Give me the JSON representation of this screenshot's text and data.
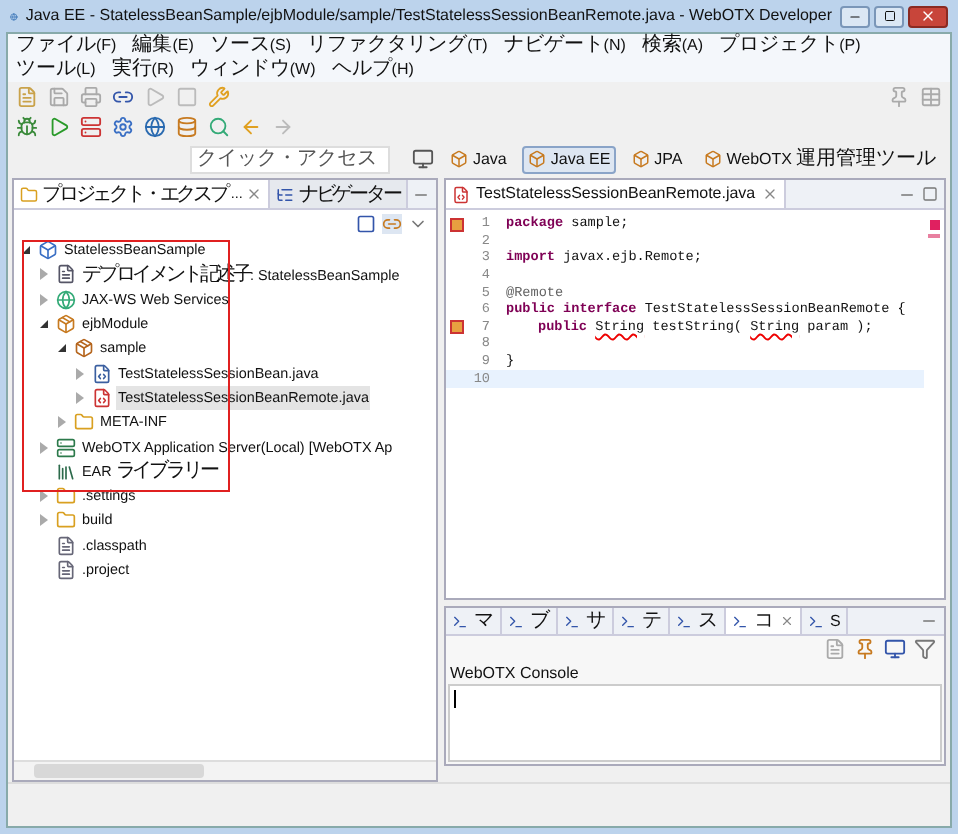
{
  "window": {
    "title": "Java EE - StatelessBeanSample/ejbModule/sample/TestStatelessSessionBeanRemote.java - WebOTX Developer"
  },
  "menu": [
    "ファイル(F)",
    "編集(E)",
    "ソース(S)",
    "リファクタリング(T)",
    "ナビゲート(N)",
    "検索(A)",
    "プロジェクト(P)",
    "ツール(L)",
    "実行(R)",
    "ウィンドウ(W)",
    "ヘルプ(H)"
  ],
  "quick_access": {
    "placeholder": "クイック・アクセス"
  },
  "perspectives": [
    {
      "label": "Java",
      "selected": false
    },
    {
      "label": "Java EE",
      "selected": true
    },
    {
      "label": "JPA",
      "selected": false
    },
    {
      "label": "WebOTX 運用管理ツール",
      "selected": false
    }
  ],
  "left_panel": {
    "tabs": [
      {
        "label": "プロジェクト・エクスプ...",
        "selected": true
      },
      {
        "label": "ナビゲーター",
        "selected": false
      }
    ],
    "tree": [
      {
        "label": "StatelessBeanSample",
        "kind": "project",
        "expanded": true,
        "selected": false,
        "children": [
          {
            "label": "デプロイメント記述子: StatelessBeanSample",
            "kind": "descriptor",
            "expanded": false,
            "selected": false
          },
          {
            "label": "JAX-WS Web Services",
            "kind": "webservice",
            "expanded": false,
            "selected": false
          },
          {
            "label": "ejbModule",
            "kind": "module",
            "expanded": true,
            "selected": false,
            "children": [
              {
                "label": "sample",
                "kind": "package",
                "expanded": true,
                "selected": false,
                "children": [
                  {
                    "label": "TestStatelessSessionBean.java",
                    "kind": "java",
                    "expanded": false,
                    "selected": false
                  },
                  {
                    "label": "TestStatelessSessionBeanRemote.java",
                    "kind": "java-error",
                    "expanded": false,
                    "selected": true
                  }
                ]
              },
              {
                "label": "META-INF",
                "kind": "folder",
                "expanded": false,
                "selected": false
              }
            ]
          },
          {
            "label": "WebOTX Application Server(Local) [WebOTX Ap",
            "kind": "server",
            "expanded": false,
            "selected": false
          },
          {
            "label": "EAR ライブラリー",
            "kind": "library",
            "selected": false
          },
          {
            "label": ".settings",
            "kind": "folder",
            "expanded": false,
            "selected": false
          },
          {
            "label": "build",
            "kind": "folder",
            "expanded": false,
            "selected": false
          },
          {
            "label": ".classpath",
            "kind": "xml",
            "selected": false
          },
          {
            "label": ".project",
            "kind": "xml",
            "selected": false
          }
        ]
      }
    ]
  },
  "editor": {
    "tab": "TestStatelessSessionBeanRemote.java",
    "lines": [
      {
        "number": "1",
        "marker": true,
        "segments": [
          {
            "text": "package",
            "kind": "keyword"
          },
          {
            "text": " sample;",
            "kind": "plain"
          }
        ]
      },
      {
        "number": "2",
        "marker": false
      },
      {
        "number": "3",
        "marker": false,
        "segments": [
          {
            "text": "import",
            "kind": "keyword"
          },
          {
            "text": " javax.ejb.Remote;",
            "kind": "plain"
          }
        ]
      },
      {
        "number": "4",
        "marker": false
      },
      {
        "number": "5",
        "marker": false,
        "segments": [
          {
            "text": "@Remote",
            "kind": "annotation"
          }
        ]
      },
      {
        "number": "6",
        "marker": false,
        "segments": [
          {
            "text": "public interface",
            "kind": "keyword"
          },
          {
            "text": " TestStatelessSessionBeanRemote {",
            "kind": "plain"
          }
        ]
      },
      {
        "number": "7",
        "marker": true,
        "indented": true,
        "segments": [
          {
            "text": "public ",
            "kind": "keyword"
          },
          {
            "text": "String",
            "kind": "error"
          },
          {
            "text": " testString( ",
            "kind": "plain"
          },
          {
            "text": "String",
            "kind": "error"
          },
          {
            "text": " param );",
            "kind": "plain"
          }
        ]
      },
      {
        "number": "8",
        "marker": false
      },
      {
        "number": "9",
        "marker": false,
        "segments": [
          {
            "text": "}",
            "kind": "plain"
          }
        ]
      },
      {
        "number": "10",
        "marker": false,
        "current": true
      }
    ]
  },
  "bottom_panel": {
    "tabs": [
      {
        "label": "マ",
        "selected": false
      },
      {
        "label": "ブ",
        "selected": false
      },
      {
        "label": "サ",
        "selected": false
      },
      {
        "label": "テ",
        "selected": false
      },
      {
        "label": "ス",
        "selected": false
      },
      {
        "label": "コ",
        "selected": true
      },
      {
        "label": "S",
        "selected": false
      }
    ],
    "console_title": "WebOTX Console"
  }
}
